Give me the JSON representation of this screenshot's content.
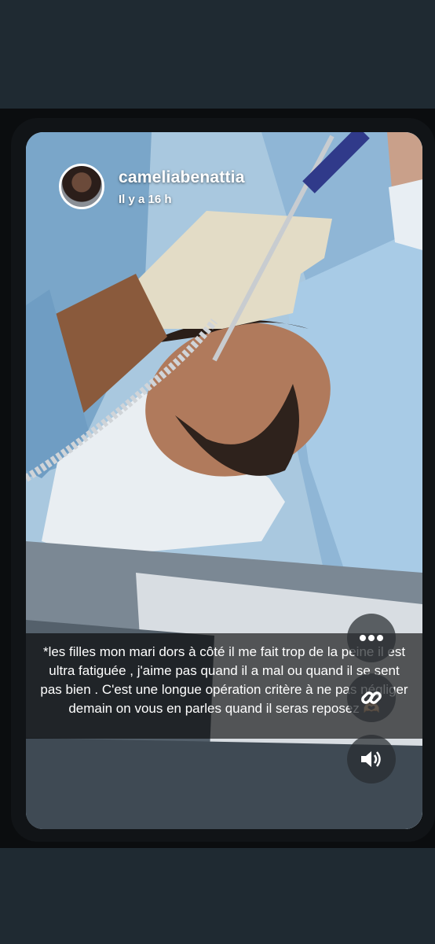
{
  "story": {
    "username": "cameliabenattia",
    "time_ago": "Il y a 16 h",
    "caption": "*les filles mon mari dors à côté il me fait trop de la peine il est ultra fatiguée , j'aime pas quand il a mal ou quand il se sent pas bien . C'est une longue opération critère à ne pas négliger demain on vous en parles quand il seras reposez 🫶🏼"
  },
  "actions": {
    "more_icon": "more-horizontal-icon",
    "link_icon": "link-icon",
    "sound_icon": "speaker-icon"
  },
  "colors": {
    "background": "#1f2a32",
    "frame": "#0b0d0f",
    "caption_overlay": "rgba(0,0,0,0.62)",
    "button_bg": "rgba(40,44,48,0.72)"
  }
}
